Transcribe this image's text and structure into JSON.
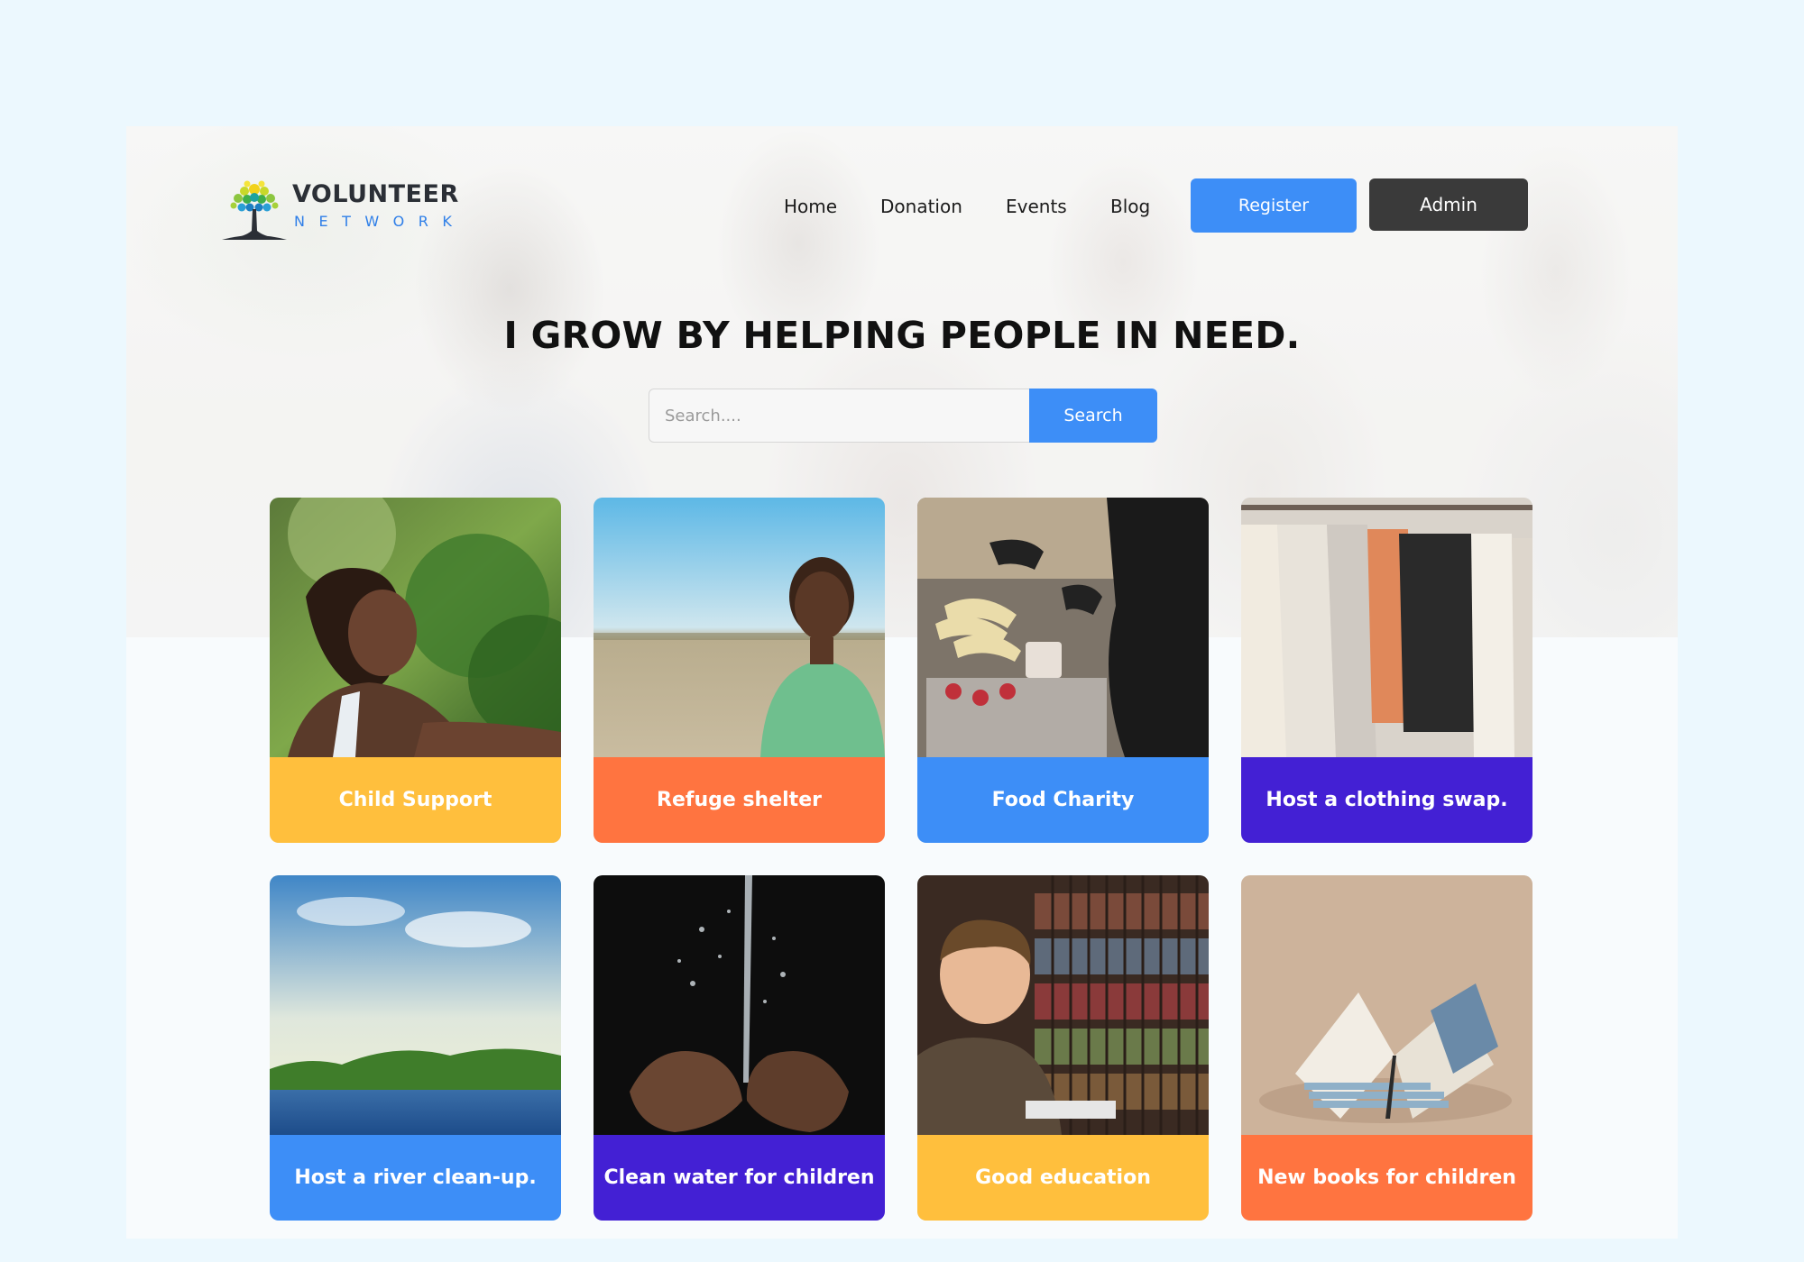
{
  "brand": {
    "name_line1": "VOLUNTEER",
    "name_line2": "NETWORK",
    "logo_icon": "tree-icon"
  },
  "nav": {
    "links": [
      "Home",
      "Donation",
      "Events",
      "Blog"
    ],
    "register_label": "Register",
    "admin_label": "Admin"
  },
  "hero": {
    "headline": "I GROW BY HELPING PEOPLE IN NEED."
  },
  "search": {
    "placeholder": "Search....",
    "button_label": "Search"
  },
  "colors": {
    "accent_blue": "#3d8ef7",
    "yellow": "#ffbf3d",
    "orange": "#ff7440",
    "purple": "#4320d4",
    "dark": "#3a3a3a",
    "page_bg": "#ecf8fe"
  },
  "cards": [
    {
      "label": "Child Support",
      "color": "#ffbf3d",
      "image": "girl-smiling-outdoors"
    },
    {
      "label": "Refuge shelter",
      "color": "#ff7440",
      "image": "boy-in-field"
    },
    {
      "label": "Food Charity",
      "color": "#3d8ef7",
      "image": "food-distribution"
    },
    {
      "label": "Host a clothing swap.",
      "color": "#4320d4",
      "image": "clothes-rack"
    },
    {
      "label": "Host a river clean-up.",
      "color": "#3d8ef7",
      "image": "river-landscape"
    },
    {
      "label": "Clean water for children",
      "color": "#4320d4",
      "image": "water-in-hands"
    },
    {
      "label": "Good education",
      "color": "#ffbf3d",
      "image": "boy-reading-library"
    },
    {
      "label": "New books for children",
      "color": "#ff7440",
      "image": "open-book"
    }
  ]
}
